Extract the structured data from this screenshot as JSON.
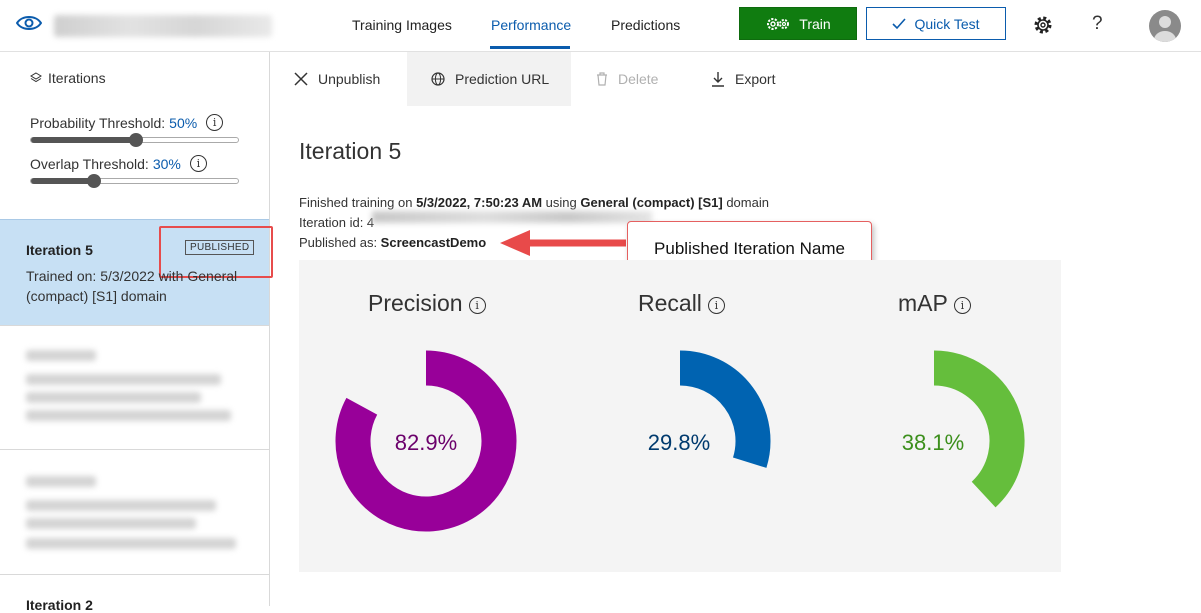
{
  "topbar": {
    "tabs": [
      "Training Images",
      "Performance",
      "Predictions"
    ],
    "active_tab": "Performance",
    "train_label": "Train",
    "quick_test_label": "Quick Test",
    "help_label": "?"
  },
  "sidebar": {
    "iterations_label": "Iterations",
    "probability_threshold": {
      "label": "Probability Threshold:",
      "value": "50%",
      "fraction": 0.5
    },
    "overlap_threshold": {
      "label": "Overlap Threshold:",
      "value": "30%",
      "fraction": 0.3
    },
    "selected_iteration": {
      "name": "Iteration 5",
      "badge": "PUBLISHED",
      "description": "Trained on: 5/3/2022 with General (compact) [S1] domain"
    },
    "bottom_iteration_name": "Iteration 2"
  },
  "commands": {
    "unpublish": "Unpublish",
    "prediction_url": "Prediction URL",
    "delete": "Delete",
    "export": "Export"
  },
  "main": {
    "title": "Iteration 5",
    "training_prefix": "Finished training on ",
    "training_date": "5/3/2022, 7:50:23 AM",
    "training_using": " using ",
    "training_domain": "General (compact) [S1]",
    "training_suffix": " domain",
    "iteration_id_label": "Iteration id: 4",
    "published_as_label": "Published as: ",
    "published_name": "ScreencastDemo",
    "callout": "Published Iteration Name"
  },
  "metrics": [
    {
      "label": "Precision",
      "value": "82.9%",
      "fraction": 0.829,
      "color": "#980099"
    },
    {
      "label": "Recall",
      "value": "29.8%",
      "fraction": 0.298,
      "color": "#0063b1"
    },
    {
      "label": "mAP",
      "value": "38.1%",
      "fraction": 0.381,
      "color": "#65be3c"
    }
  ]
}
